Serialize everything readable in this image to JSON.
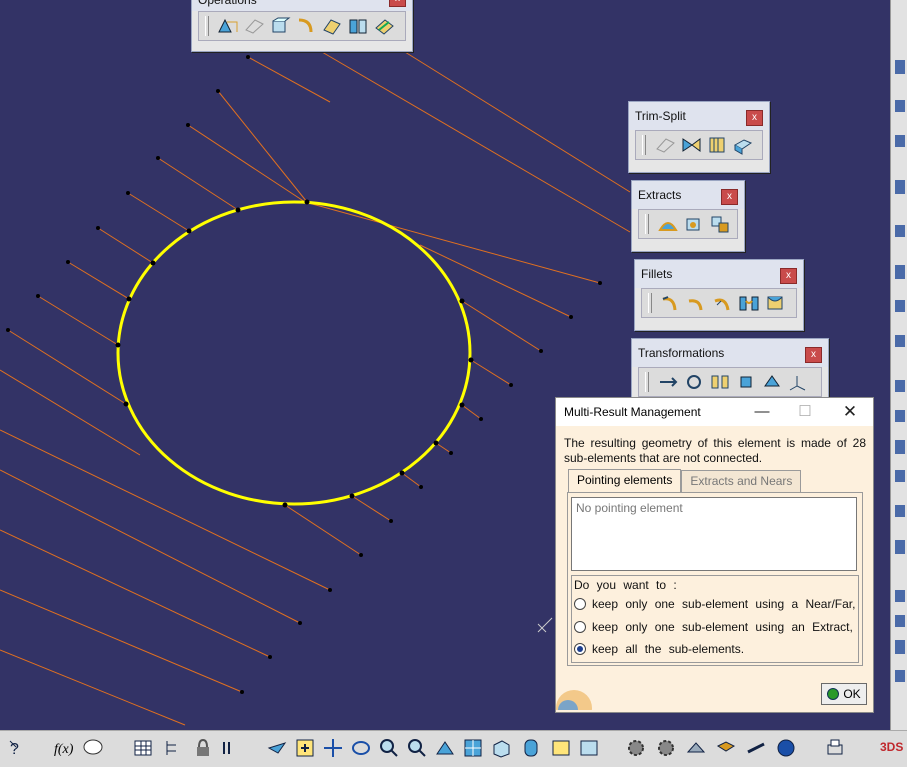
{
  "toolbars": {
    "operations": {
      "title": "Operations",
      "close": "x"
    },
    "trim_split": {
      "title": "Trim-Split",
      "close": "x"
    },
    "extracts": {
      "title": "Extracts",
      "close": "x"
    },
    "fillets": {
      "title": "Fillets",
      "close": "x"
    },
    "transformations": {
      "title": "Transformations",
      "close": "x"
    }
  },
  "dialog": {
    "title": "Multi-Result  Management",
    "message": "The resulting geometry of this element is made of 28 sub-elements that are not connected.",
    "tabs": [
      {
        "label": "Pointing elements",
        "active": true
      },
      {
        "label": "Extracts and Nears",
        "active": false
      }
    ],
    "list_placeholder": "No pointing element",
    "question": "Do you want to :",
    "options": [
      {
        "label": "keep  only  one  sub-element using a Near/Far,",
        "selected": false
      },
      {
        "label": "keep  only  one  sub-element using an Extract,",
        "selected": false
      },
      {
        "label": "keep all the sub-elements.",
        "selected": true
      }
    ],
    "ok_label": "OK"
  },
  "colors": {
    "viewport_background": "#333366",
    "circle": "#ffff00",
    "lines": "#e07020"
  }
}
